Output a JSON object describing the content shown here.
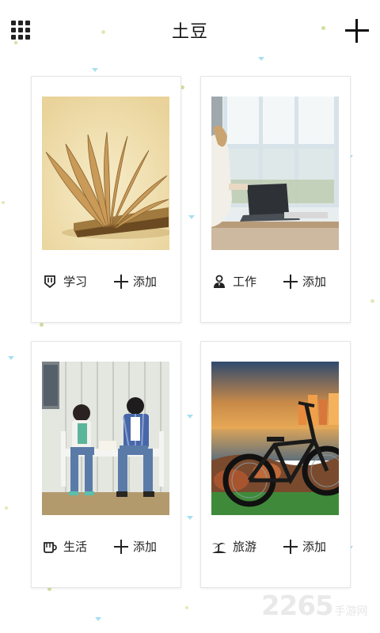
{
  "header": {
    "title": "土豆"
  },
  "cards": [
    {
      "category": "学习",
      "icon": "badge-icon",
      "add_label": "添加"
    },
    {
      "category": "工作",
      "icon": "person-icon",
      "add_label": "添加"
    },
    {
      "category": "生活",
      "icon": "cup-icon",
      "add_label": "添加"
    },
    {
      "category": "旅游",
      "icon": "palm-tree-icon",
      "add_label": "添加"
    }
  ],
  "watermark": {
    "number": "2265",
    "text": "手游网"
  },
  "colors": {
    "background": "#ffffff",
    "card_border": "#e6e6e6",
    "decor_dot_green": "#cfe0a0",
    "decor_triangle_blue": "#a8e0ef"
  }
}
